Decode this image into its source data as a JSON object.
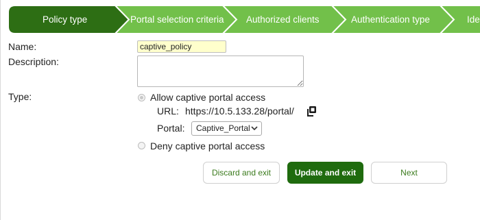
{
  "wizard": {
    "steps": [
      {
        "label": "Policy type",
        "active": true
      },
      {
        "label": "Portal selection criteria",
        "active": false
      },
      {
        "label": "Authorized clients",
        "active": false
      },
      {
        "label": "Authentication type",
        "active": false
      },
      {
        "label": "Ide",
        "active": false
      }
    ],
    "colors": {
      "active": "#2d6e14",
      "inactive": "#72c04a",
      "separator": "#ffffff"
    }
  },
  "form": {
    "name_label": "Name:",
    "name_value": "captive_policy",
    "description_label": "Description:",
    "description_value": "",
    "type_label": "Type:",
    "options": {
      "allow": {
        "label": "Allow captive portal access",
        "selected": true
      },
      "deny": {
        "label": "Deny captive portal access",
        "selected": false
      }
    },
    "url_label": "URL:",
    "url_value": "https://10.5.133.28/portal/",
    "copy_icon": "copy-icon",
    "portal_label": "Portal:",
    "portal_selected": "Captive_Portal"
  },
  "buttons": {
    "discard": "Discard and exit",
    "update": "Update and exit",
    "next": "Next"
  }
}
